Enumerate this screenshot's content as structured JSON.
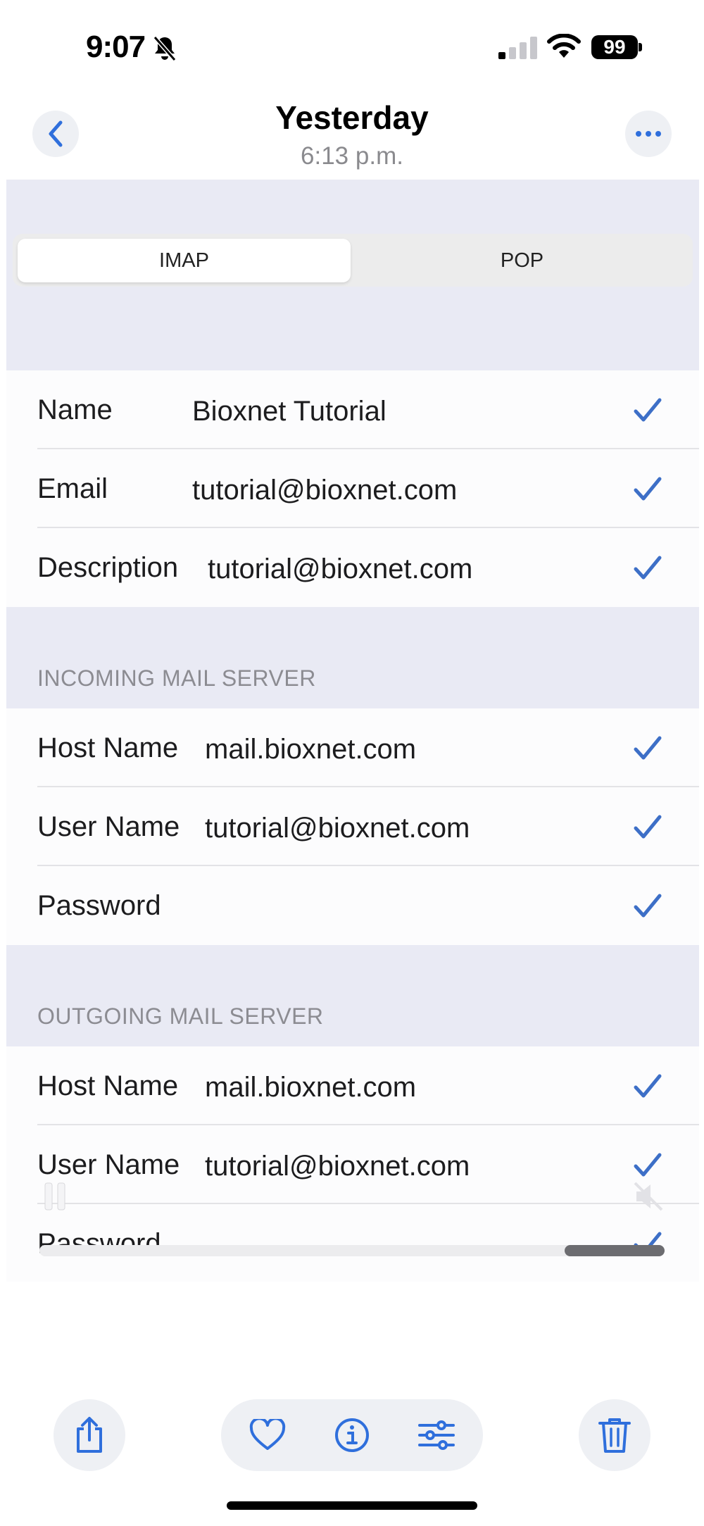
{
  "status_bar": {
    "time": "9:07",
    "battery": "99"
  },
  "nav": {
    "title": "Yesterday",
    "subtitle": "6:13 p.m."
  },
  "segment": {
    "options": [
      "IMAP",
      "POP"
    ],
    "selected": "IMAP"
  },
  "account": {
    "rows": [
      {
        "label": "Name",
        "value": "Bioxnet Tutorial"
      },
      {
        "label": "Email",
        "value": "tutorial@bioxnet.com"
      },
      {
        "label": "Description",
        "value": "tutorial@bioxnet.com"
      }
    ]
  },
  "incoming": {
    "header": "INCOMING MAIL SERVER",
    "rows": [
      {
        "label": "Host Name",
        "value": "mail.bioxnet.com"
      },
      {
        "label": "User Name",
        "value": "tutorial@bioxnet.com"
      },
      {
        "label": "Password",
        "value": ""
      }
    ]
  },
  "outgoing": {
    "header": "OUTGOING MAIL SERVER",
    "rows": [
      {
        "label": "Host Name",
        "value": "mail.bioxnet.com"
      },
      {
        "label": "User Name",
        "value": "tutorial@bioxnet.com"
      },
      {
        "label": "Password",
        "value": ""
      }
    ]
  },
  "video": {
    "progress": 0.84
  },
  "colors": {
    "accent": "#2f6fdc",
    "check": "#3d6fc7",
    "grouped_bg": "#e9eaf4"
  },
  "toolbar": {
    "icons": [
      "share-icon",
      "heart-icon",
      "info-icon",
      "adjust-icon",
      "trash-icon"
    ]
  }
}
